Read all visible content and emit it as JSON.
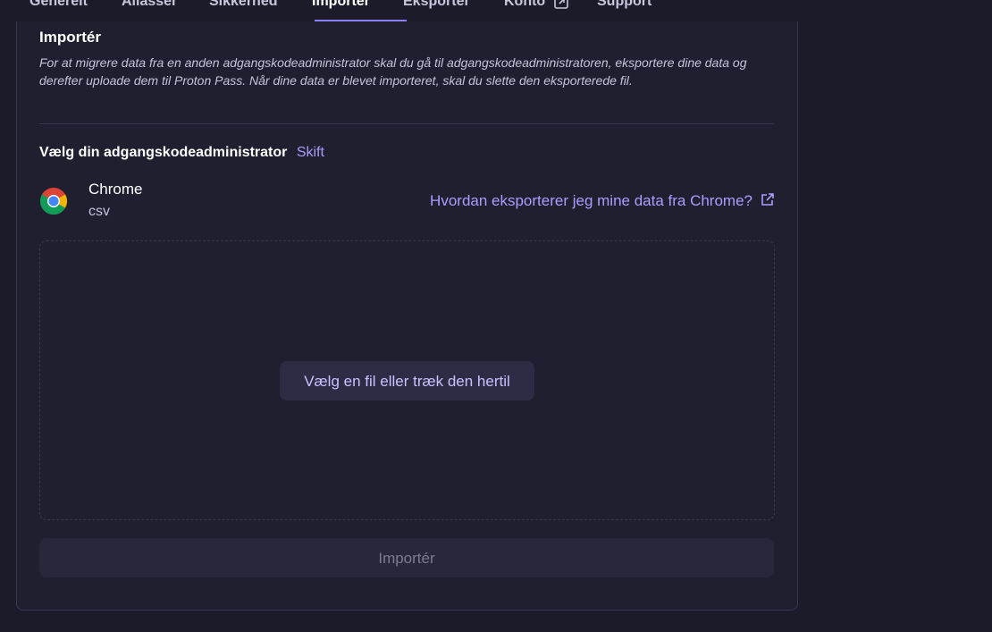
{
  "tabs": [
    {
      "label": "Generelt"
    },
    {
      "label": "Aliasser"
    },
    {
      "label": "Sikkerhed"
    },
    {
      "label": "Importer"
    },
    {
      "label": "Eksporter"
    },
    {
      "label": "Konto"
    },
    {
      "label": "Support"
    }
  ],
  "active_tab": "Importer",
  "import": {
    "title": "Importér",
    "description": "For at migrere data fra en anden adgangskodeadministrator skal du gå til adgangskodeadministratoren, eksportere dine data og derefter uploade dem til Proton Pass. Når dine data er blevet importeret, skal du slette den eksporterede fil.",
    "choose_label": "Vælg din adgangskodeadministrator",
    "switch_label": "Skift",
    "provider": {
      "name": "Chrome",
      "format": "csv",
      "icon": "chrome-icon"
    },
    "help_link": "Hvordan eksporterer jeg mine data fra Chrome?",
    "dropzone_button": "Vælg en fil eller træk den hertil",
    "import_button": "Importér"
  },
  "colors": {
    "background": "#1c1b29",
    "panel": "#201f2f",
    "accent": "#a89eff",
    "border": "#3a384f"
  }
}
